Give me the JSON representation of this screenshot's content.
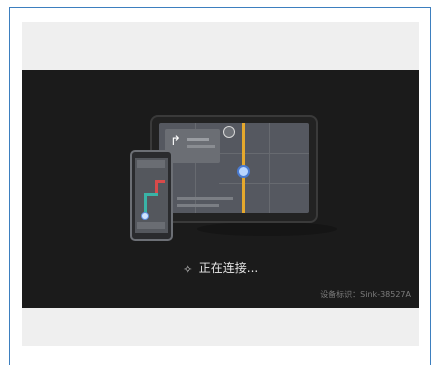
{
  "status": {
    "text": "正在连接...",
    "spinner_icon": "spinner-icon"
  },
  "device": {
    "label_text": "设备标识：Sink-38527A"
  },
  "illustration": {
    "tablet_icon": "tablet-nav-illustration",
    "phone_icon": "phone-nav-illustration",
    "turn_arrow": "↱"
  },
  "colors": {
    "screen_bg": "#1b1b1b",
    "route_orange": "#e5a82d",
    "route_red": "#d84a4a",
    "route_teal": "#39b3a6",
    "frame_border": "#3d7fbf"
  }
}
